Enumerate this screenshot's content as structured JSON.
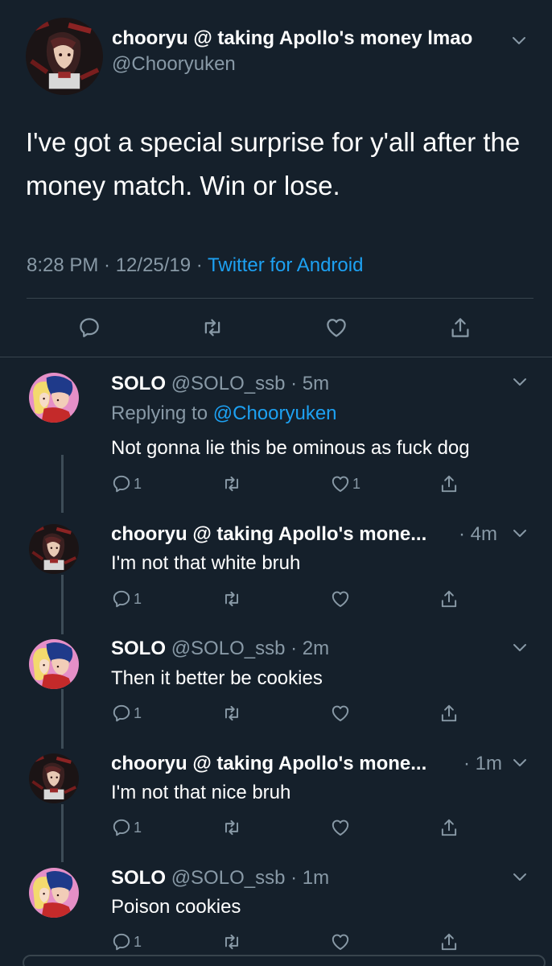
{
  "main_tweet": {
    "display_name": "chooryu @ taking Apollo's money lmao",
    "handle": "@Chooryuken",
    "text": "I've got a special surprise for y'all after the money match. Win or lose.",
    "meta_time": "8:28 PM · 12/25/19 · ",
    "source": "Twitter for Android"
  },
  "replies": [
    {
      "name": "SOLO",
      "handle": "@SOLO_ssb",
      "time": " · 5m",
      "replying_prefix": "Replying to ",
      "replying_to": "@Chooryuken",
      "text": "Not gonna lie this be ominous as fuck dog",
      "reply_count": "1",
      "like_count": "1"
    },
    {
      "name": "chooryu @ taking Apollo's mone...",
      "time": "· 4m",
      "text": "I'm not that white bruh",
      "reply_count": "1"
    },
    {
      "name": "SOLO",
      "handle": "@SOLO_ssb",
      "time": " · 2m",
      "text": "Then it better be cookies",
      "reply_count": "1"
    },
    {
      "name": "chooryu @ taking Apollo's mone...",
      "time": "· 1m",
      "text": "I'm not that nice bruh",
      "reply_count": "1"
    },
    {
      "name": "SOLO",
      "handle": "@SOLO_ssb",
      "time": " · 1m",
      "text": "Poison cookies",
      "reply_count": "1"
    }
  ],
  "icons": {
    "reply": "reply-icon",
    "retweet": "retweet-icon",
    "like": "heart-icon",
    "share": "share-icon",
    "more": "chevron-down-icon"
  },
  "colors": {
    "background": "#15202b",
    "secondary_text": "#8899a6",
    "link": "#1da1f2",
    "divider": "#38444d"
  }
}
